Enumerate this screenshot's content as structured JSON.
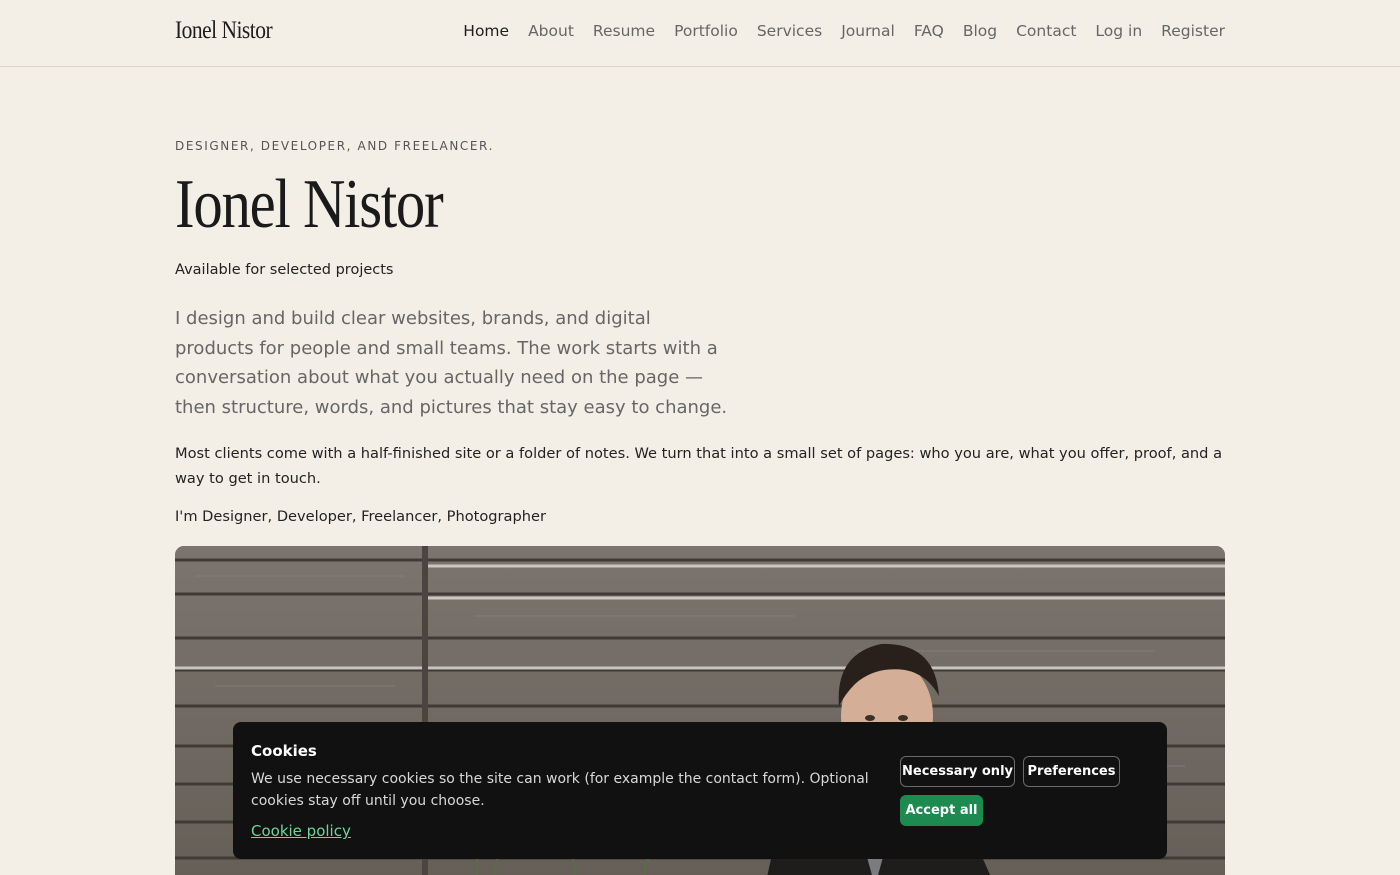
{
  "header": {
    "brand": "Ionel Nistor",
    "nav": [
      {
        "label": "Home",
        "active": true
      },
      {
        "label": "About"
      },
      {
        "label": "Resume"
      },
      {
        "label": "Portfolio"
      },
      {
        "label": "Services"
      },
      {
        "label": "Journal"
      },
      {
        "label": "FAQ"
      },
      {
        "label": "Blog"
      },
      {
        "label": "Contact"
      },
      {
        "label": "Log in"
      },
      {
        "label": "Register"
      }
    ]
  },
  "hero": {
    "eyebrow": "DESIGNER, DEVELOPER, AND FREELANCER.",
    "title": "Ionel Nistor",
    "availability": "Available for selected projects",
    "lead": "I design and build clear websites, brands, and digital products for people and small teams. The work starts with a conversation about what you actually need on the page — then structure, words, and pictures that stay easy to change.",
    "body": "Most clients come with a half-finished site or a folder of notes. We turn that into a small set of pages: who you are, what you offer, proof, and a way to get in touch.",
    "roles": "I'm Designer, Developer, Freelancer, Photographer"
  },
  "cookie": {
    "title": "Cookies",
    "text": "We use necessary cookies so the site can work (for example the contact form). Optional cookies stay off until you choose.",
    "policy_link": "Cookie policy",
    "necessary_label": "Necessary only",
    "preferences_label": "Preferences",
    "accept_label": "Accept all"
  },
  "colors": {
    "background": "#f3efe7",
    "accept_button": "#1d8a4f",
    "policy_link": "#6fd49a",
    "banner": "#111111"
  }
}
